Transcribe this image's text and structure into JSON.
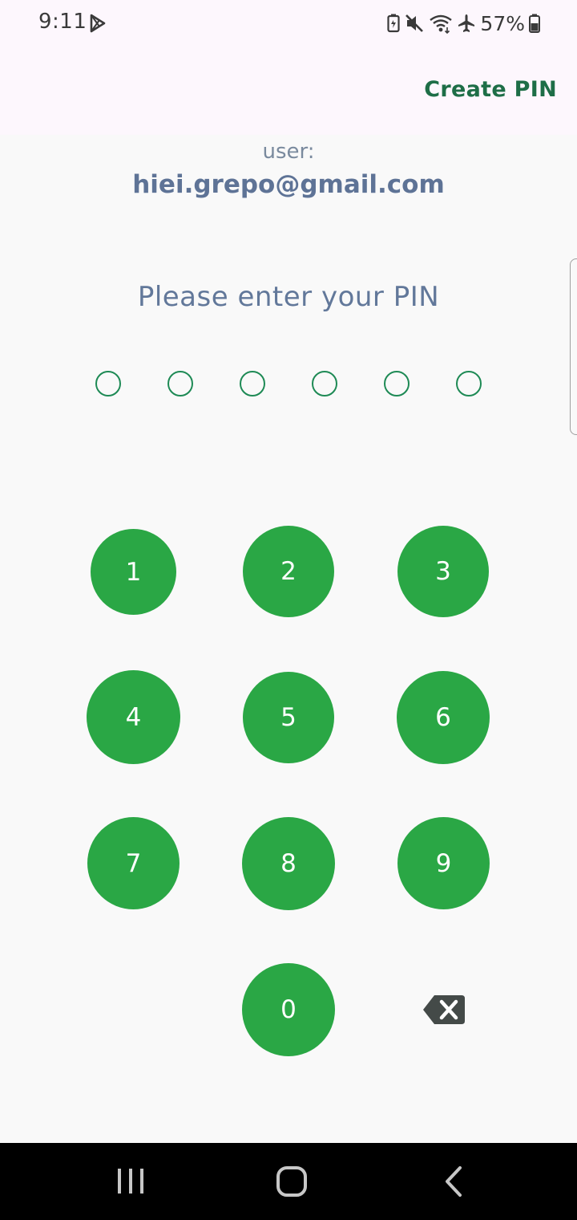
{
  "status_bar": {
    "time": "9:11",
    "battery": "57%",
    "icons": [
      "play-store-icon",
      "battery-saver-icon",
      "mute-icon",
      "wifi-icon",
      "airplane-mode-icon",
      "battery-icon"
    ]
  },
  "app_bar": {
    "action_label": "Create PIN"
  },
  "user": {
    "label": "user:",
    "email": "hiei.grepo@gmail.com"
  },
  "prompt": "Please enter your PIN",
  "pin": {
    "length": 6,
    "entered": 0
  },
  "keypad": {
    "keys": [
      "1",
      "2",
      "3",
      "4",
      "5",
      "6",
      "7",
      "8",
      "9",
      "0"
    ],
    "backspace_icon": "backspace-icon"
  },
  "nav_bar": {
    "buttons": [
      "recent-apps-icon",
      "home-icon",
      "back-icon"
    ]
  },
  "colors": {
    "accent_green": "#2aa745",
    "create_pin_text": "#1e6e47",
    "pin_dot_outline": "#1e8a55",
    "prompt_text": "#62789a",
    "email_text": "#5e7396",
    "top_bar_bg": "#fdf7fd",
    "page_bg": "#f9f9f9"
  }
}
